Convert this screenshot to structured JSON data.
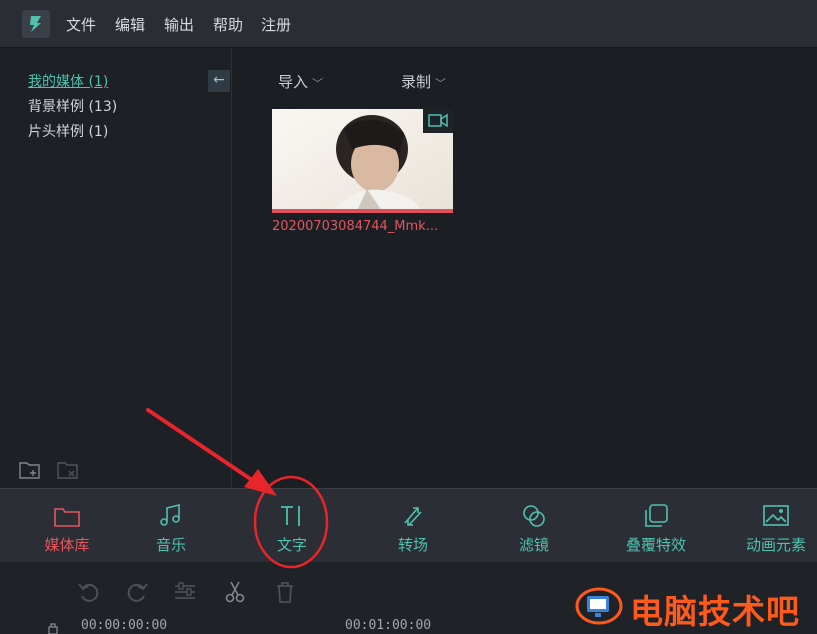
{
  "menubar": {
    "items": [
      "文件",
      "编辑",
      "输出",
      "帮助",
      "注册"
    ]
  },
  "library_tree": {
    "items": [
      {
        "label": "我的媒体 (1)",
        "active": true
      },
      {
        "label": "背景样例 (13)",
        "active": false
      },
      {
        "label": "片头样例 (1)",
        "active": false
      }
    ]
  },
  "media_toolbar": {
    "import_label": "导入",
    "record_label": "录制"
  },
  "media_items": [
    {
      "filename": "20200703084744_Mmk...",
      "type": "video"
    }
  ],
  "tabs": [
    {
      "label": "媒体库",
      "icon": "folder-icon",
      "active": true
    },
    {
      "label": "音乐",
      "icon": "music-note-icon",
      "active": false
    },
    {
      "label": "文字",
      "icon": "text-cursor-icon",
      "active": false
    },
    {
      "label": "转场",
      "icon": "transition-icon",
      "active": false
    },
    {
      "label": "滤镜",
      "icon": "filter-circles-icon",
      "active": false
    },
    {
      "label": "叠覆特效",
      "icon": "overlay-icon",
      "active": false
    },
    {
      "label": "动画元素",
      "icon": "image-icon",
      "active": false
    }
  ],
  "timeline": {
    "tools": [
      "undo-icon",
      "redo-icon",
      "adjust-icon",
      "cut-icon",
      "delete-icon"
    ],
    "ruler": [
      "00:00:00:00",
      "00:01:00:00"
    ]
  },
  "watermark": {
    "text": "电脑技术吧"
  },
  "colors": {
    "accent_teal": "#4fc1ae",
    "accent_red": "#e2575f",
    "annotation_red": "#e8252b",
    "watermark_orange": "#ff5a1c"
  }
}
